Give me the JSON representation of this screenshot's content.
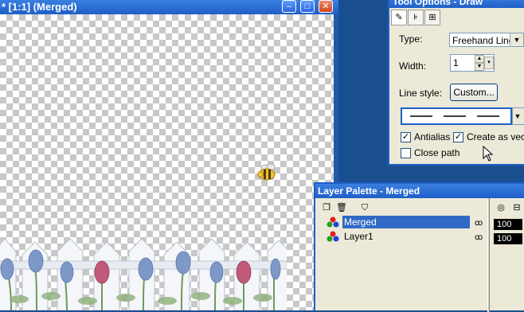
{
  "canvas_window": {
    "title": "* [1:1] (Merged)",
    "minimize": "–",
    "maximize": "□",
    "close": "✕"
  },
  "tool_options": {
    "title": "Tool Options - Draw",
    "type_label": "Type:",
    "type_value": "Freehand Line",
    "width_label": "Width:",
    "width_value": "1",
    "line_style_label": "Line style:",
    "custom_button": "Custom...",
    "antialias_label": "Antialias",
    "antialias_checked": true,
    "create_vector_label": "Create as vecto",
    "create_vector_checked": true,
    "close_path_label": "Close path",
    "close_path_checked": false
  },
  "layer_palette": {
    "title": "Layer Palette - Merged",
    "layers": [
      {
        "name": "Merged",
        "selected": true,
        "opacity": "100"
      },
      {
        "name": "Layer1",
        "selected": false,
        "opacity": "100"
      }
    ]
  }
}
